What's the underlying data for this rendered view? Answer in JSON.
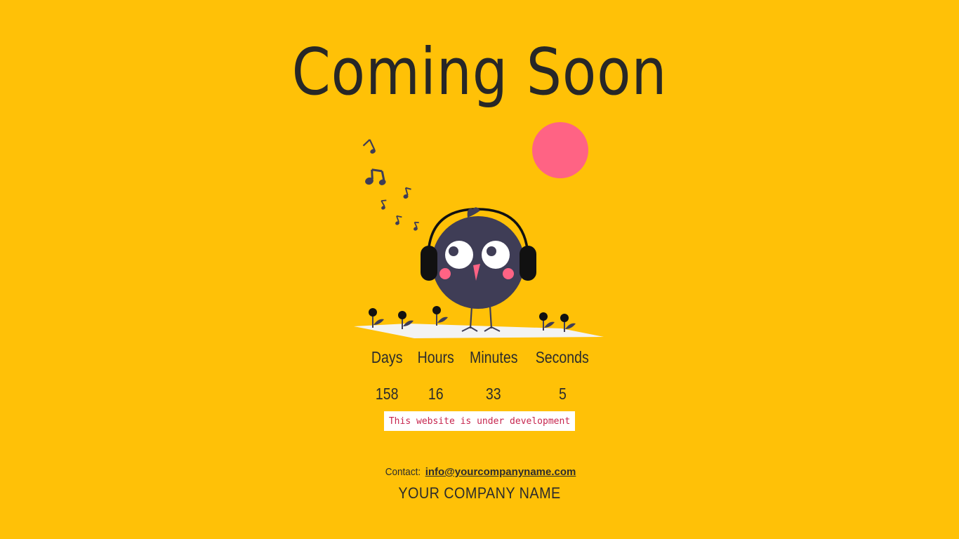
{
  "page": {
    "title": "Coming Soon"
  },
  "colors": {
    "background": "#FFC107",
    "text": "#2a2a2a",
    "sun": "#FF6384",
    "bird_body": "#3F3D56",
    "cheek": "#FF6384",
    "badge_text": "#c7254e"
  },
  "illustration": {
    "icons": [
      "music-notes-icon",
      "sun-icon",
      "bird-with-headphones-icon",
      "flower-icon"
    ]
  },
  "countdown": {
    "days_label": "Days",
    "hours_label": "Hours",
    "minutes_label": "Minutes",
    "seconds_label": "Seconds",
    "days": "158",
    "hours": "16",
    "minutes": "33",
    "seconds": "5"
  },
  "notice": {
    "text": "This website is under development"
  },
  "footer": {
    "contact_label": "Contact:",
    "email": "info@yourcompanyname.com",
    "company_name": "YOUR COMPANY NAME"
  }
}
